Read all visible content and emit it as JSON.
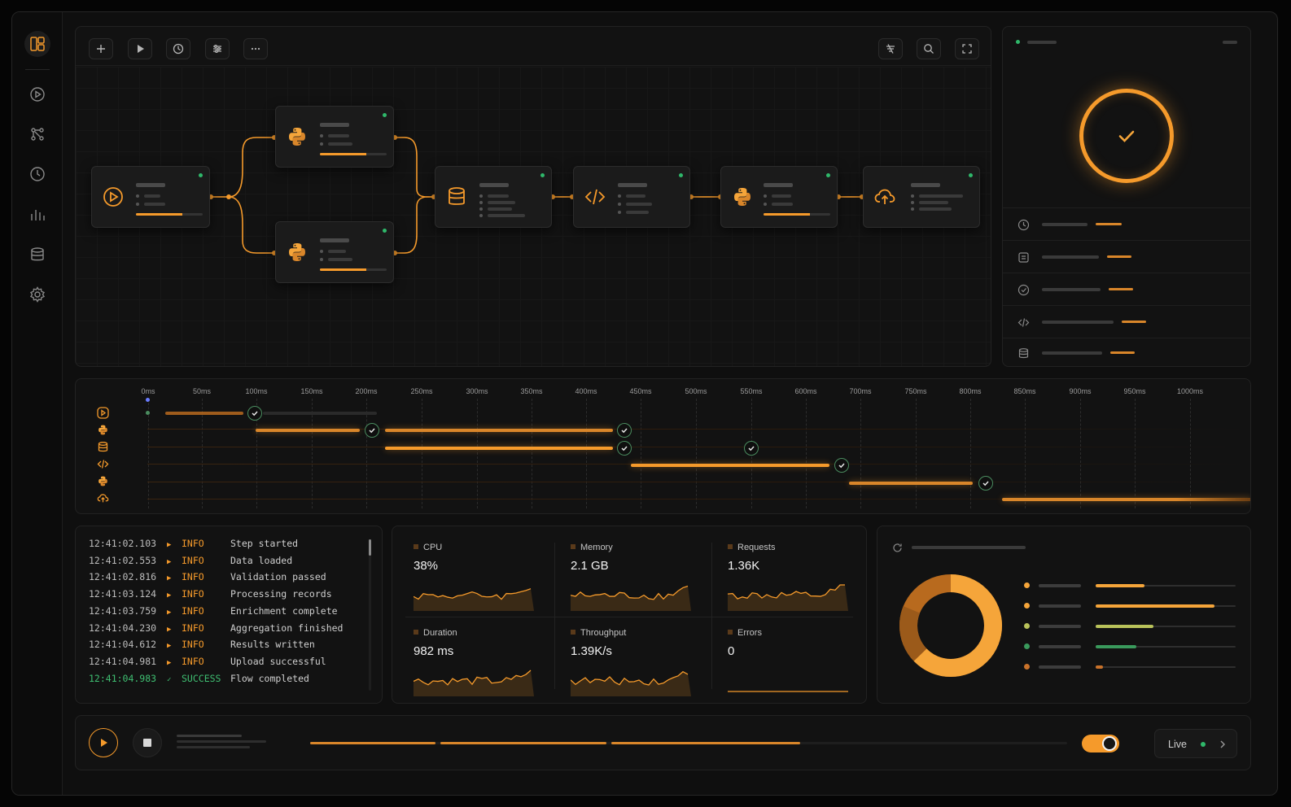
{
  "sidebar": {
    "icons": [
      "layout-icon",
      "play-circle-icon",
      "workflow-icon",
      "clock-icon",
      "chart-icon",
      "database-icon",
      "settings-icon"
    ]
  },
  "toolbar": {
    "left": [
      "plus-icon",
      "play-icon",
      "clock-icon",
      "sliders-icon",
      "more-icon"
    ],
    "right": [
      "filter-icon",
      "search-icon",
      "fullscreen-icon"
    ]
  },
  "flow": {
    "nodes": [
      {
        "id": "trigger",
        "icon": "play-circle-icon",
        "status": "complete",
        "progress": 0.7
      },
      {
        "id": "python-a",
        "icon": "python-icon",
        "status": "complete",
        "progress": 0.7
      },
      {
        "id": "python-b",
        "icon": "python-icon",
        "status": "complete",
        "progress": 0.7
      },
      {
        "id": "database",
        "icon": "database-icon",
        "status": "complete"
      },
      {
        "id": "code",
        "icon": "code-icon",
        "status": "complete"
      },
      {
        "id": "python-c",
        "icon": "python-icon",
        "status": "complete",
        "progress": 0.7
      },
      {
        "id": "upload",
        "icon": "cloud-upload-icon",
        "status": "complete"
      }
    ]
  },
  "details": {
    "status_icon": "check-icon",
    "rows": [
      {
        "icon": "clock-icon",
        "accent": 0.25
      },
      {
        "icon": "list-icon",
        "accent": 0.25
      },
      {
        "icon": "check-circle-icon",
        "accent": 0.25
      },
      {
        "icon": "code-icon",
        "accent": 0.25
      },
      {
        "icon": "database-icon",
        "accent": 0.25
      }
    ]
  },
  "timeline": {
    "ticks": [
      "0ms",
      "50ms",
      "100ms",
      "150ms",
      "200ms",
      "250ms",
      "300ms",
      "350ms",
      "400ms",
      "450ms",
      "500ms",
      "550ms",
      "600ms",
      "700ms",
      "750ms",
      "800ms",
      "850ms",
      "900ms",
      "950ms",
      "1000ms"
    ],
    "rows": [
      "play-circle-icon",
      "python-icon",
      "database-icon",
      "code-icon",
      "python-icon",
      "cloud-upload-icon"
    ]
  },
  "logs": [
    {
      "time": "12:41:02.103",
      "level": "INFO",
      "message": "Step started"
    },
    {
      "time": "12:41:02.553",
      "level": "INFO",
      "message": "Data loaded"
    },
    {
      "time": "12:41:02.816",
      "level": "INFO",
      "message": "Validation passed"
    },
    {
      "time": "12:41:03.124",
      "level": "INFO",
      "message": "Processing records"
    },
    {
      "time": "12:41:03.759",
      "level": "INFO",
      "message": "Enrichment complete"
    },
    {
      "time": "12:41:04.230",
      "level": "INFO",
      "message": "Aggregation finished"
    },
    {
      "time": "12:41:04.612",
      "level": "INFO",
      "message": "Results written"
    },
    {
      "time": "12:41:04.981",
      "level": "INFO",
      "message": "Upload successful"
    },
    {
      "time": "12:41:04.983",
      "level": "SUCCESS",
      "message": "Flow completed"
    }
  ],
  "metrics": [
    {
      "label": "CPU",
      "value": "38%"
    },
    {
      "label": "Memory",
      "value": "2.1 GB"
    },
    {
      "label": "Requests",
      "value": "1.36K"
    },
    {
      "label": "Duration",
      "value": "982 ms"
    },
    {
      "label": "Throughput",
      "value": "1.39K/s"
    },
    {
      "label": "Errors",
      "value": "0"
    }
  ],
  "breakdown": {
    "header_icon": "refresh-icon",
    "legend": [
      {
        "color": "#f5a53a",
        "fill": 0.35
      },
      {
        "color": "#f5a53a",
        "fill": 0.85
      },
      {
        "color": "#b9c25a",
        "fill": 0.41
      },
      {
        "color": "#3a9a5c",
        "fill": 0.29
      },
      {
        "color": "#c9722a",
        "fill": 0.05
      }
    ]
  },
  "player": {
    "live_label": "Live",
    "toggle_on": true,
    "colors": {
      "accent": "#f59a2b",
      "success": "#3fbf72"
    }
  }
}
